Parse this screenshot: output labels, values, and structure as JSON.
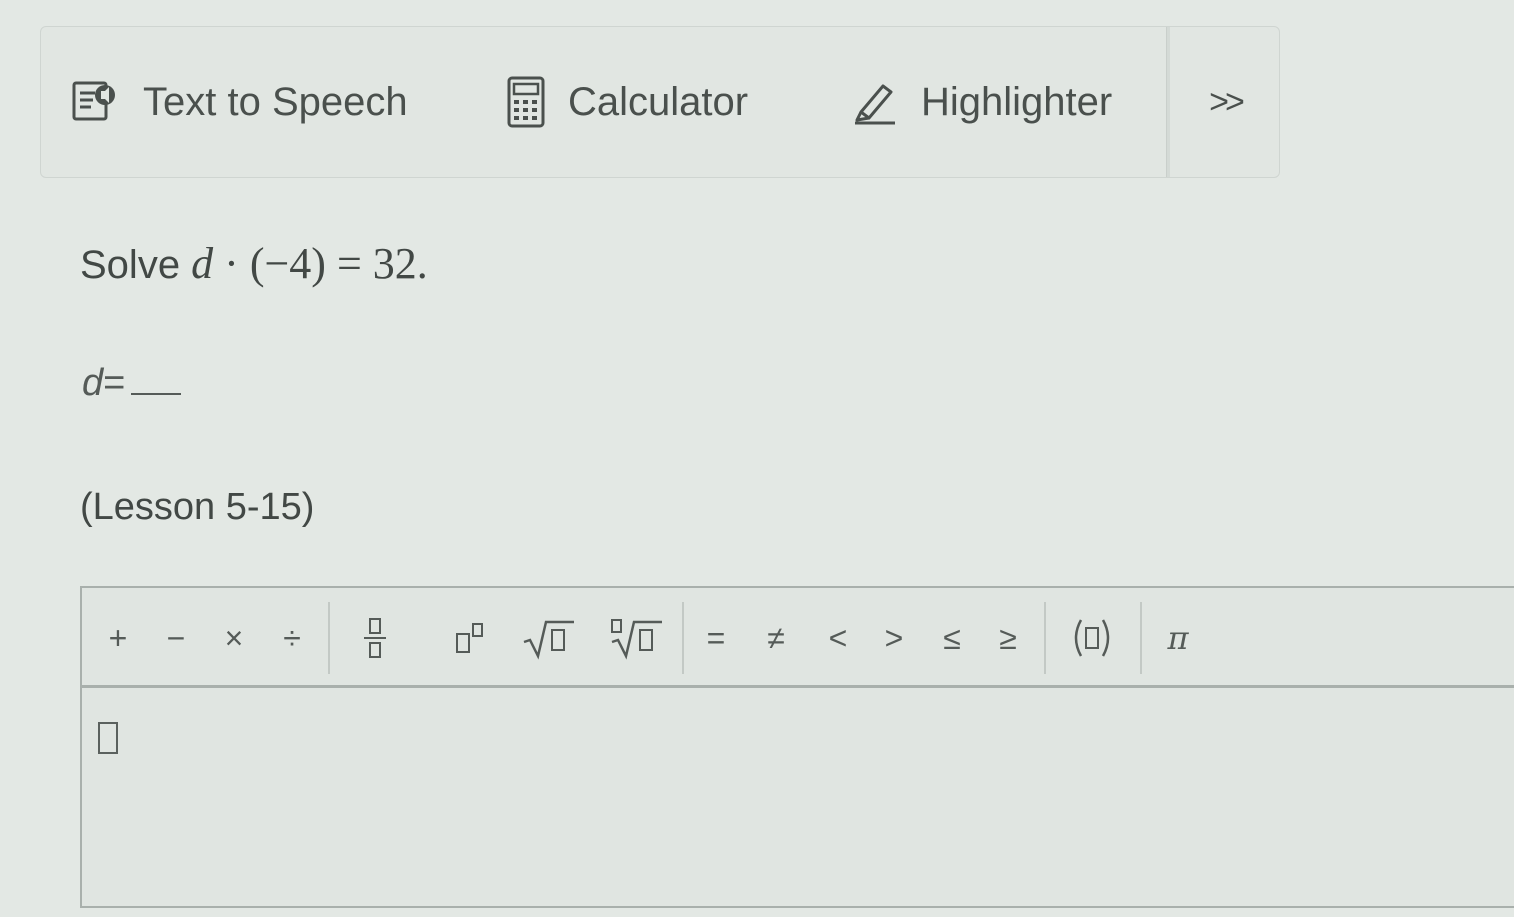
{
  "toolbar": {
    "text_to_speech": "Text to Speech",
    "calculator": "Calculator",
    "highlighter": "Highlighter",
    "more": ">>"
  },
  "question": {
    "prefix": "Solve ",
    "variable": "d",
    "equation_rest": " · (−4) = 32."
  },
  "answer": {
    "variable": "d",
    "equals": "="
  },
  "lesson": "(Lesson 5-15)",
  "palette": {
    "plus": "+",
    "minus": "−",
    "times": "×",
    "divide": "÷",
    "equals": "=",
    "not_equal": "≠",
    "less": "<",
    "greater": ">",
    "less_equal": "≤",
    "greater_equal": "≥",
    "pi": "π"
  }
}
